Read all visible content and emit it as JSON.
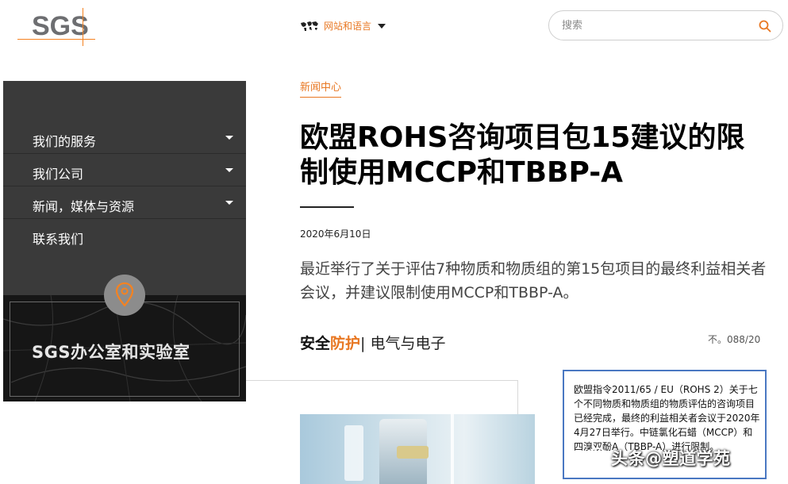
{
  "header": {
    "logo_text": "SGS",
    "lang_label": "网站和语言",
    "search_placeholder": "搜索"
  },
  "sidebar": {
    "items": [
      {
        "label": "我们的服务",
        "has_caret": true
      },
      {
        "label": "我们公司",
        "has_caret": true
      },
      {
        "label": "新闻，媒体与资源",
        "has_caret": true
      },
      {
        "label": "联系我们",
        "has_caret": false
      }
    ],
    "office_title": "SGS办公室和实验室"
  },
  "article": {
    "breadcrumb": "新闻中心",
    "title": "欧盟ROHS咨询项目包15建议的限制使用MCCP和TBBP-A",
    "date": "2020年6月10日",
    "summary": "最近举行了关于评估7种物质和物质组的第15包项目的最终利益相关者会议，并建议限制使用MCCP和TBBP-A。",
    "category_part1": "安全",
    "category_part2": "防护",
    "category_rest": "| 电气与电子",
    "reference": "不。088/20"
  },
  "overlay": {
    "text": "欧盟指令2011/65 / EU（ROHS 2）关于七个不同物质和物质组的物质评估的咨询项目已经完成，最终的利益相关者会议于2020年4月27日举行。中链氯化石蜡（MCCP）和四溴双酚A（TBBP-A）进行限制。"
  },
  "watermark": {
    "text": "头条@塑道学苑"
  },
  "colors": {
    "accent": "#e87722",
    "sidebar_bg": "#3a3a3a",
    "overlay_border": "#4a78c2"
  }
}
